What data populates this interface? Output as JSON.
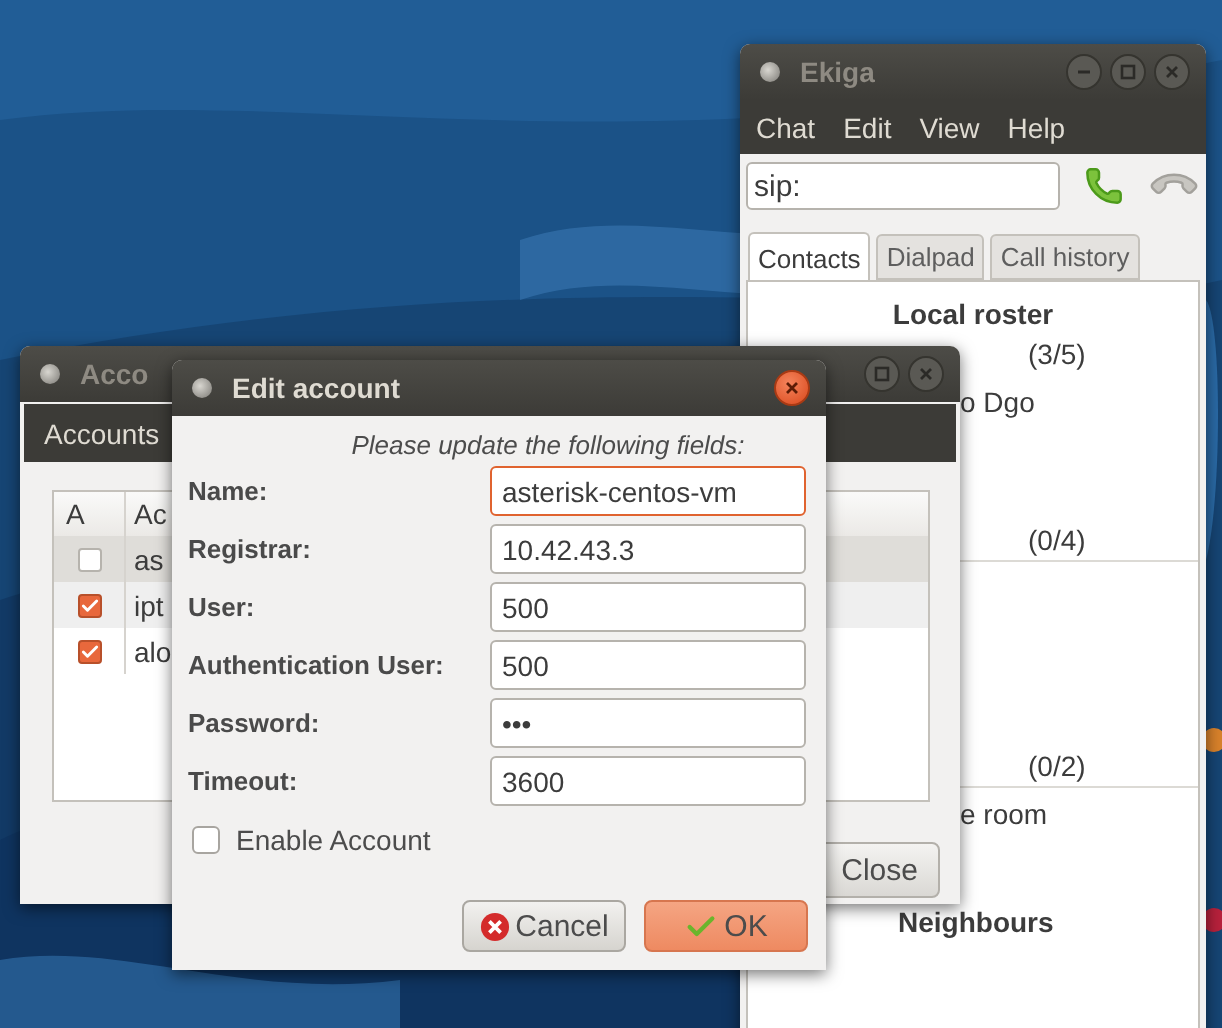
{
  "ekiga": {
    "title": "Ekiga",
    "active": false,
    "menu": [
      "Chat",
      "Edit",
      "View",
      "Help"
    ],
    "address": {
      "value": "sip:"
    },
    "tabs": [
      {
        "label": "Contacts",
        "selected": true
      },
      {
        "label": "Dialpad",
        "selected": false
      },
      {
        "label": "Call history",
        "selected": false
      }
    ],
    "roster": [
      {
        "kind": "heading",
        "text": "Local roster"
      },
      {
        "kind": "count",
        "text": "(3/5)"
      },
      {
        "kind": "contact",
        "text": "o Dgo"
      },
      {
        "kind": "count",
        "text": "(0/4)"
      },
      {
        "kind": "divider"
      },
      {
        "kind": "count",
        "text": "(0/2)"
      },
      {
        "kind": "divider"
      },
      {
        "kind": "contact",
        "text": "e room"
      },
      {
        "kind": "group",
        "text": "Neighbours"
      }
    ]
  },
  "accounts": {
    "title": "Acco",
    "active": false,
    "toolbar": "Accounts",
    "columns": [
      "A",
      "Ac"
    ],
    "rows": [
      {
        "name": "as",
        "enabled": false,
        "selected": true
      },
      {
        "name": "ipt",
        "enabled": true,
        "selected": false
      },
      {
        "name": "alo",
        "enabled": true,
        "selected": false
      }
    ],
    "close_button": "Close"
  },
  "dialog": {
    "title": "Edit account",
    "active": true,
    "instructions": "Please update the following fields:",
    "fields": [
      {
        "label": "Name:",
        "value": "asterisk-centos-vm",
        "focused": true
      },
      {
        "label": "Registrar:",
        "value": "10.42.43.3",
        "focused": false
      },
      {
        "label": "User:",
        "value": "500",
        "focused": false
      },
      {
        "label": "Authentication User:",
        "value": "500",
        "focused": false
      },
      {
        "label": "Password:",
        "value": "•••",
        "focused": false
      },
      {
        "label": "Timeout:",
        "value": "3600",
        "focused": false
      }
    ],
    "enable_account": {
      "label": "Enable Account",
      "checked": false
    },
    "buttons": [
      {
        "label": "Cancel",
        "kind": "cancel"
      },
      {
        "label": "OK",
        "kind": "ok"
      }
    ]
  }
}
